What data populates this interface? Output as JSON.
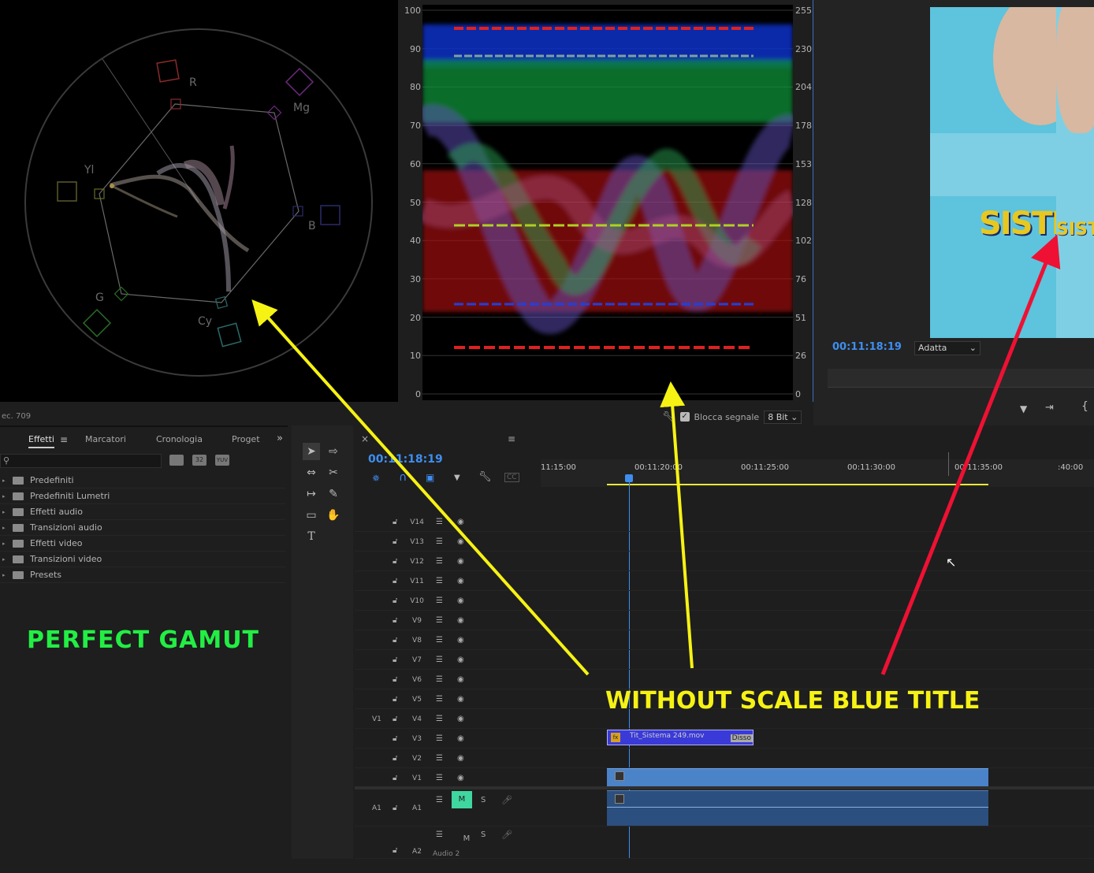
{
  "vectorscope": {
    "labels": {
      "r": "R",
      "mg": "Mg",
      "yl": "Yl",
      "b": "B",
      "g": "G",
      "cy": "Cy"
    },
    "standard_label": "ec. 709"
  },
  "waveform": {
    "left_ticks": [
      "100",
      "90",
      "80",
      "70",
      "60",
      "50",
      "40",
      "30",
      "20",
      "10",
      "0"
    ],
    "right_ticks": [
      "255",
      "230",
      "204",
      "178",
      "153",
      "128",
      "102",
      "76",
      "51",
      "26",
      "0"
    ],
    "blocca_label": "Blocca segnale",
    "bit_depth": "8 Bit"
  },
  "program": {
    "timecode": "00:11:18:19",
    "fit": "Adatta",
    "overlay_text": "SISTI",
    "overlay_text2": "SIST"
  },
  "effects_panel": {
    "tabs": [
      "Effetti",
      "Marcatori",
      "Cronologia",
      "Proget"
    ],
    "toolbar_badges": [
      "32",
      "YUV"
    ],
    "folders": [
      "Predefiniti",
      "Predefiniti Lumetri",
      "Effetti audio",
      "Transizioni audio",
      "Effetti video",
      "Transizioni video",
      "Presets"
    ]
  },
  "timeline": {
    "timecode": "00:11:18:19",
    "ruler_labels": [
      "11:15:00",
      "00:11:20:00",
      "00:11:25:00",
      "00:11:30:00",
      "00:11:35:00",
      ":40:00"
    ],
    "video_tracks": [
      "V14",
      "V13",
      "V12",
      "V11",
      "V10",
      "V9",
      "V8",
      "V7",
      "V6",
      "V5",
      "V4",
      "V3",
      "V2",
      "V1"
    ],
    "v1_source": "V1",
    "a1_source": "A1",
    "audio_tracks": [
      {
        "name": "A1",
        "m": "M",
        "s": "S"
      },
      {
        "name": "A2",
        "m": "M",
        "s": "S",
        "sub": "Audio 2"
      }
    ],
    "clip_v3": {
      "name": "Tit_Sistema 249.mov",
      "tag": "Disso"
    }
  },
  "annotations": {
    "green": "PERFECT GAMUT",
    "yellow": "WITHOUT SCALE BLUE TITLE"
  },
  "colors": {
    "green": "#22ee44",
    "yellow": "#f6f214",
    "red": "#ee1133",
    "blue_ui": "#3e8ef0"
  }
}
